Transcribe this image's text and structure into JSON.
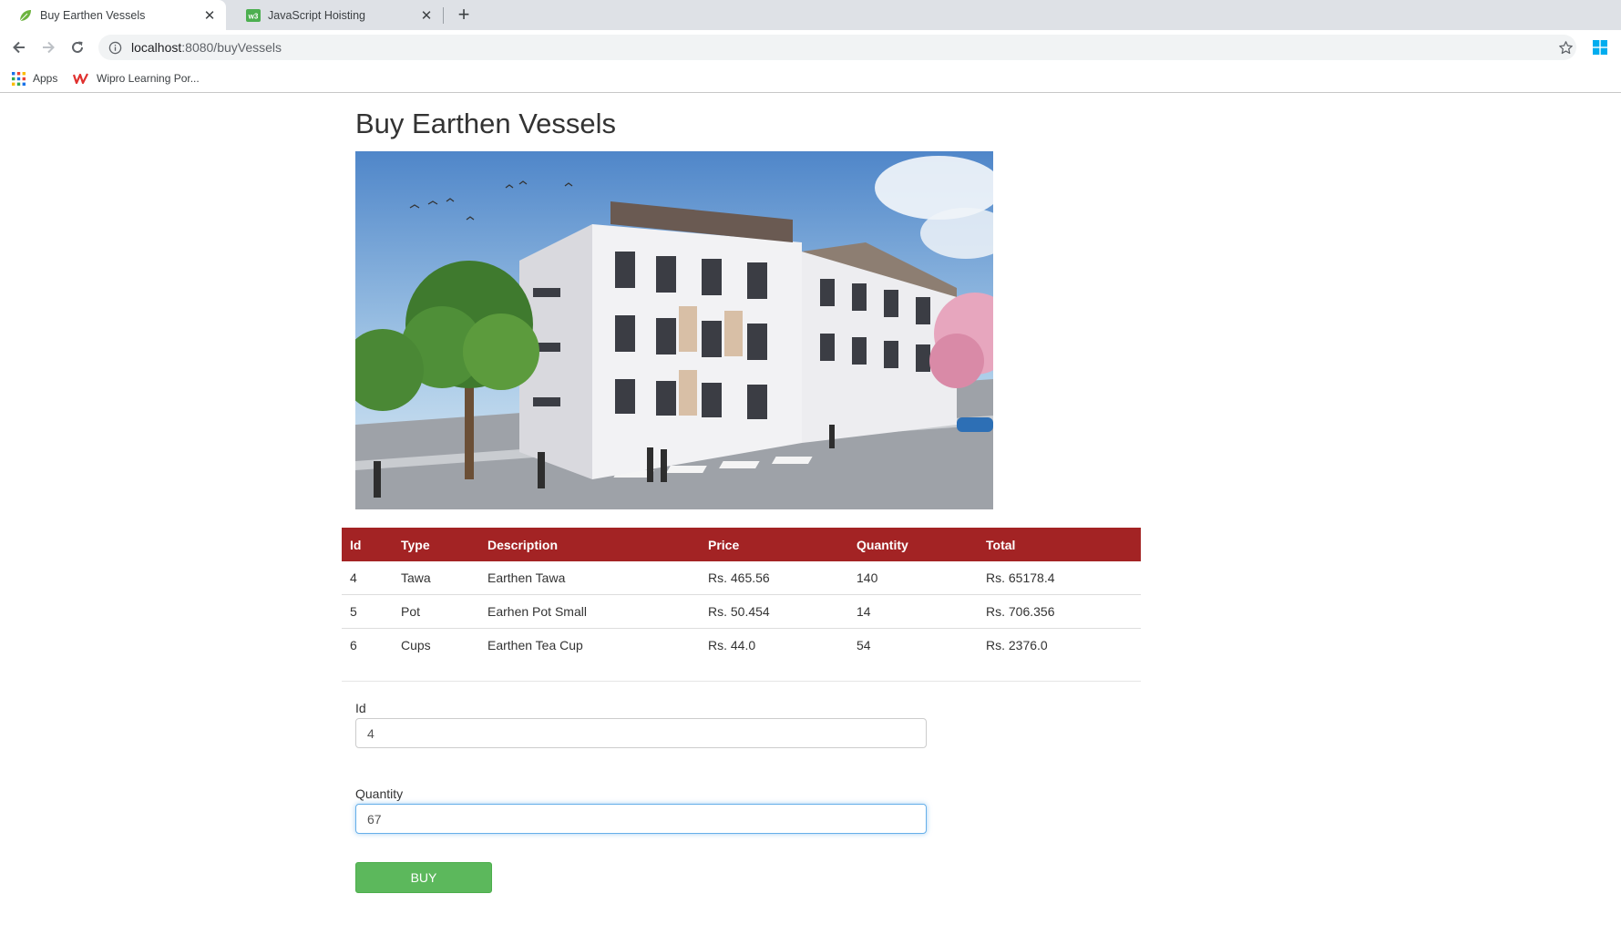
{
  "browser": {
    "tabs": [
      {
        "title": "Buy Earthen Vessels",
        "active": true,
        "favicon": "leaf-icon"
      },
      {
        "title": "JavaScript Hoisting",
        "active": false,
        "favicon": "w3-icon"
      }
    ],
    "url": {
      "host": "localhost",
      "rest": ":8080/buyVessels"
    },
    "bookmarks": [
      {
        "label": "Apps",
        "icon": "apps-grid-icon"
      },
      {
        "label": "Wipro Learning Por...",
        "icon": "wipro-icon"
      }
    ]
  },
  "page": {
    "title": "Buy Earthen Vessels",
    "table": {
      "headers": [
        "Id",
        "Type",
        "Description",
        "Price",
        "Quantity",
        "Total"
      ],
      "rows": [
        [
          "4",
          "Tawa",
          "Earthen Tawa",
          "Rs. 465.56",
          "140",
          "Rs. 65178.4"
        ],
        [
          "5",
          "Pot",
          "Earhen Pot Small",
          "Rs. 50.454",
          "14",
          "Rs. 706.356"
        ],
        [
          "6",
          "Cups",
          "Earthen Tea Cup",
          "Rs. 44.0",
          "54",
          "Rs. 2376.0"
        ]
      ]
    },
    "form": {
      "id_label": "Id",
      "id_value": "4",
      "quantity_label": "Quantity",
      "quantity_value": "67",
      "buy_label": "BUY"
    }
  },
  "colors": {
    "table_header": "#a32324",
    "buy_button": "#5cb85c",
    "focus_ring": "#66afe9"
  }
}
